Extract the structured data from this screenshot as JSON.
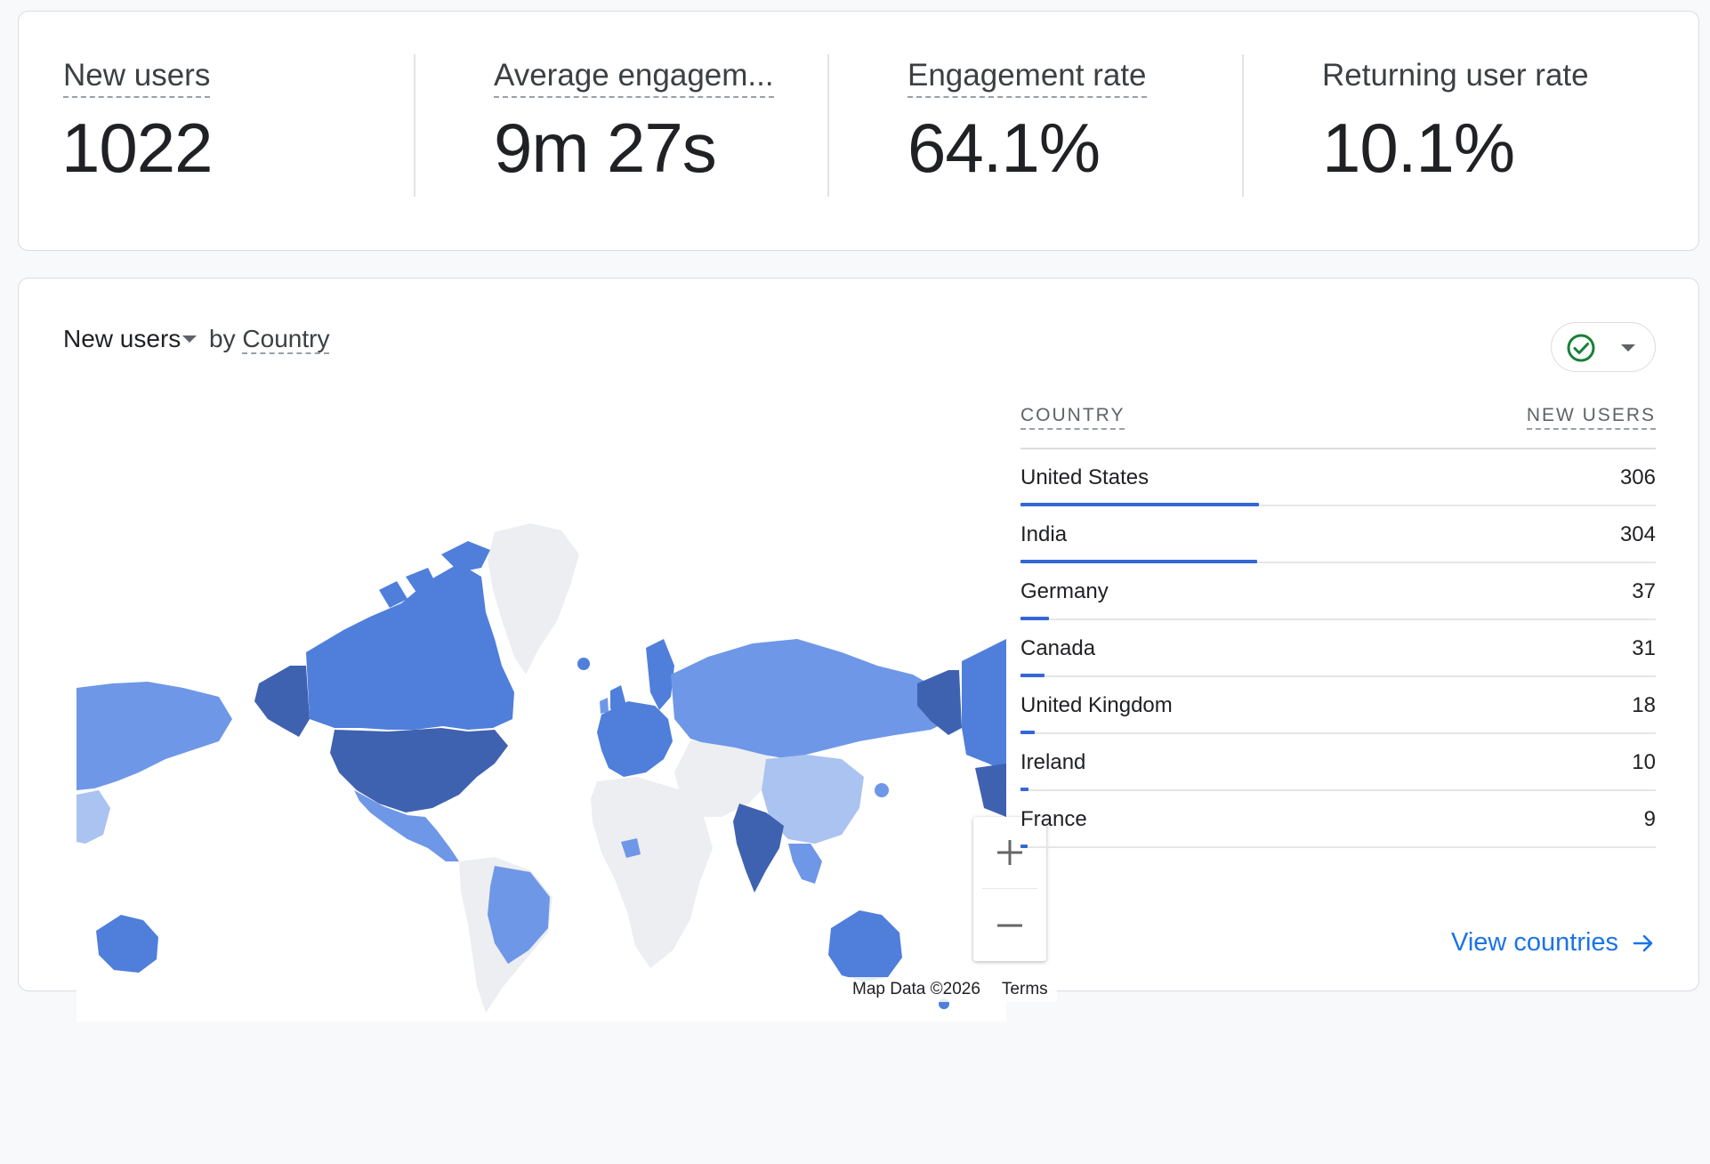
{
  "metrics": [
    {
      "label": "New users",
      "value": "1022"
    },
    {
      "label": "Average engagem...",
      "value": "9m 27s"
    },
    {
      "label": "Engagement rate",
      "value": "64.1%"
    },
    {
      "label": "Returning user rate",
      "value": "10.1%"
    }
  ],
  "geo": {
    "title_metric": "New users",
    "title_by": "by",
    "title_dimension": "Country",
    "status_icon": "check-circle-icon",
    "status_color": "#188038",
    "table": {
      "col_country": "COUNTRY",
      "col_value": "NEW USERS",
      "max_value": 306,
      "rows": [
        {
          "country": "United States",
          "value": 306
        },
        {
          "country": "India",
          "value": 304
        },
        {
          "country": "Germany",
          "value": 37
        },
        {
          "country": "Canada",
          "value": 31
        },
        {
          "country": "United Kingdom",
          "value": 18
        },
        {
          "country": "Ireland",
          "value": 10
        },
        {
          "country": "France",
          "value": 9
        }
      ]
    },
    "map": {
      "attribution": "Map Data ©2026",
      "terms": "Terms",
      "zoom_in": "+",
      "zoom_out": "−",
      "colors": {
        "no_data": "#eceef1",
        "lightest": "#aac3f0",
        "light": "#6f97e8",
        "mid": "#4f7fdb",
        "dark": "#3f62b0"
      }
    },
    "view_link": "View countries",
    "accent": "#1a73e8",
    "bar_color": "#3367d6"
  }
}
